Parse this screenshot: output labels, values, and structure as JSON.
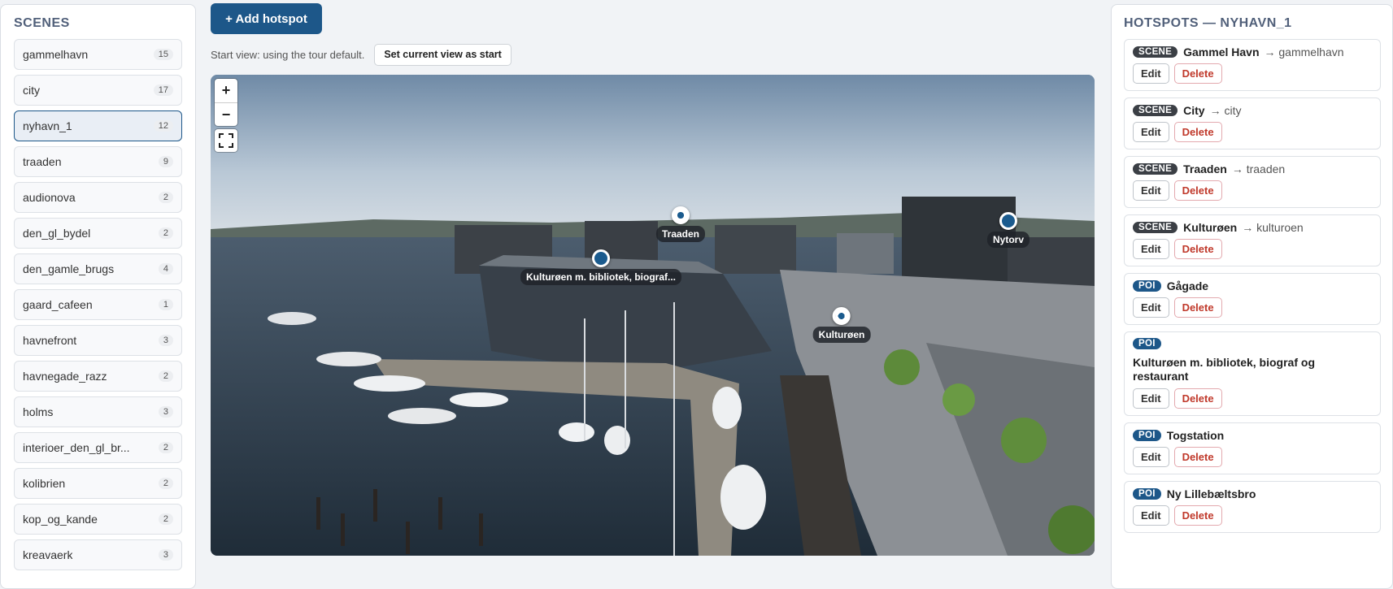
{
  "scenes": {
    "title": "SCENES",
    "items": [
      {
        "name": "gammelhavn",
        "count": "15"
      },
      {
        "name": "city",
        "count": "17"
      },
      {
        "name": "nyhavn_1",
        "count": "12"
      },
      {
        "name": "traaden",
        "count": "9"
      },
      {
        "name": "audionova",
        "count": "2"
      },
      {
        "name": "den_gl_bydel",
        "count": "2"
      },
      {
        "name": "den_gamle_brugs",
        "count": "4"
      },
      {
        "name": "gaard_cafeen",
        "count": "1"
      },
      {
        "name": "havnefront",
        "count": "3"
      },
      {
        "name": "havnegade_razz",
        "count": "2"
      },
      {
        "name": "holms",
        "count": "3"
      },
      {
        "name": "interioer_den_gl_br...",
        "count": "2"
      },
      {
        "name": "kolibrien",
        "count": "2"
      },
      {
        "name": "kop_og_kande",
        "count": "2"
      },
      {
        "name": "kreavaerk",
        "count": "3"
      }
    ],
    "active": "nyhavn_1"
  },
  "toolbar": {
    "add_hotspot": "+ Add hotspot",
    "start_view_text": "Start view: using the tour default.",
    "set_start": "Set current view as start"
  },
  "viewer": {
    "zoom_in": "+",
    "zoom_out": "−",
    "markers": [
      {
        "label": "Traaden",
        "style": "light"
      },
      {
        "label": "Nytorv",
        "style": "dark"
      },
      {
        "label": "Kulturøen m. bibliotek, biograf...",
        "style": "dark"
      },
      {
        "label": "Kulturøen",
        "style": "light"
      }
    ]
  },
  "hotspots": {
    "title": "HOTSPOTS — NYHAVN_1",
    "edit": "Edit",
    "delete": "Delete",
    "items": [
      {
        "type": "SCENE",
        "title": "Gammel Havn",
        "target": "→ gammelhavn"
      },
      {
        "type": "SCENE",
        "title": "City",
        "target": "→ city"
      },
      {
        "type": "SCENE",
        "title": "Traaden",
        "target": "→ traaden"
      },
      {
        "type": "SCENE",
        "title": "Kulturøen",
        "target": "→ kulturoen"
      },
      {
        "type": "POI",
        "title": "Gågade",
        "target": ""
      },
      {
        "type": "POI",
        "title": "Kulturøen m. bibliotek, biograf og restaurant",
        "target": ""
      },
      {
        "type": "POI",
        "title": "Togstation",
        "target": ""
      },
      {
        "type": "POI",
        "title": "Ny Lillebæltsbro",
        "target": ""
      }
    ]
  },
  "colors": {
    "accent": "#1d5789",
    "delete": "#c0392b",
    "scene_tag": "#3b3f45"
  }
}
